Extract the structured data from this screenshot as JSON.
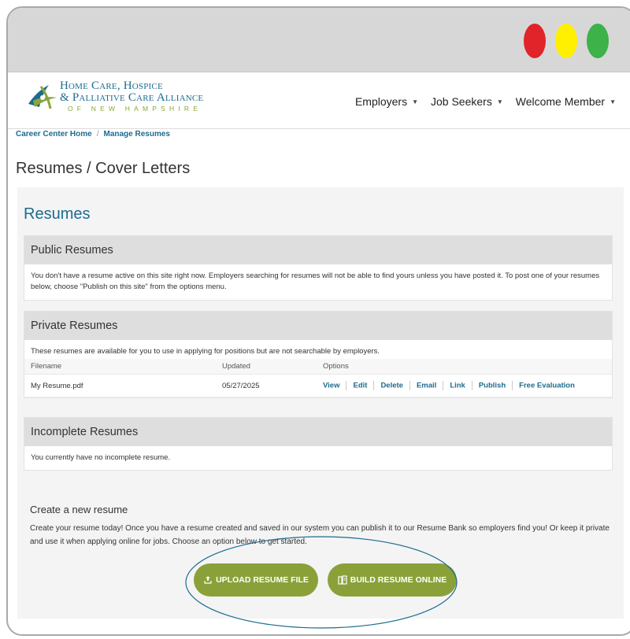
{
  "header": {
    "logo": {
      "line1": "Home Care, Hospice",
      "line2": "& Palliative Care Alliance",
      "line3": "OF NEW HAMPSHIRE"
    },
    "nav": [
      {
        "label": "Employers"
      },
      {
        "label": "Job Seekers"
      },
      {
        "label": "Welcome Member"
      }
    ]
  },
  "breadcrumb": {
    "home": "Career Center Home",
    "separator": "/",
    "current": "Manage Resumes"
  },
  "page_title": "Resumes / Cover Letters",
  "resumes": {
    "title": "Resumes",
    "public": {
      "heading": "Public Resumes",
      "text": "You don't have a resume active on this site right now. Employers searching for resumes will not be able to find yours unless you have posted it. To post one of your resumes below, choose \"Publish on this site\" from the options menu."
    },
    "private": {
      "heading": "Private Resumes",
      "text": "These resumes are available for you to use in applying for positions but are not searchable by employers.",
      "columns": [
        "Filename",
        "Updated",
        "Options"
      ],
      "rows": [
        {
          "filename": "My Resume.pdf",
          "updated": "05/27/2025"
        }
      ],
      "options": [
        "View",
        "Edit",
        "Delete",
        "Email",
        "Link",
        "Publish",
        "Free Evaluation"
      ]
    },
    "incomplete": {
      "heading": "Incomplete Resumes",
      "text": "You currently have no incomplete resume."
    },
    "create": {
      "heading": "Create a new resume",
      "text": "Create your resume today! Once you have a resume created and saved in our system you can publish it to our Resume Bank so employers find you! Or keep it private and use it when applying online for jobs. Choose an option below to get started.",
      "upload_label": "UPLOAD RESUME FILE",
      "build_label": "BUILD RESUME ONLINE"
    }
  },
  "colors": {
    "accent_blue": "#1d6b8f",
    "button_green": "#8aa139",
    "window_red": "#e0242a",
    "window_yellow": "#ffef00",
    "window_green": "#3cb249",
    "highlight_ellipse": "#1d6b8f"
  },
  "icons": [
    "upload-icon",
    "build-icon",
    "caret-down-icon",
    "logo-mark-icon"
  ]
}
